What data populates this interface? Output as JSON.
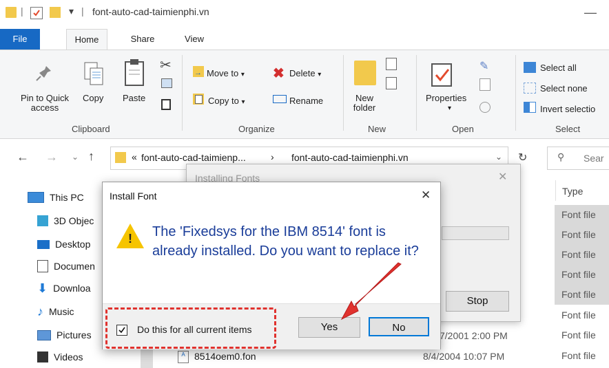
{
  "window": {
    "title": "font-auto-cad-taimienphi.vn",
    "separator": "|",
    "minimize_glyph": "—",
    "pin_glyph": "⌄"
  },
  "tabs": [
    "File",
    "Home",
    "Share",
    "View"
  ],
  "ribbon": {
    "clipboard": {
      "group_label": "Clipboard",
      "pin_label_1": "Pin to Quick",
      "pin_label_2": "access",
      "copy": "Copy",
      "paste": "Paste"
    },
    "organize": {
      "group_label": "Organize",
      "move_to": "Move to",
      "copy_to": "Copy to",
      "delete": "Delete",
      "rename": "Rename"
    },
    "new": {
      "group_label": "New",
      "new_folder_1": "New",
      "new_folder_2": "folder"
    },
    "open": {
      "group_label": "Open",
      "properties": "Properties"
    },
    "select": {
      "group_label": "Select",
      "select_all": "Select all",
      "select_none": "Select none",
      "invert_selection": "Invert selectio"
    }
  },
  "address": {
    "prefix": "«",
    "crumb1": "font-auto-cad-taimienp...",
    "chevron": "›",
    "crumb2": "font-auto-cad-taimienphi.vn",
    "search_placeholder": "Sear"
  },
  "sidebar": {
    "items": [
      {
        "label": "This PC"
      },
      {
        "label": "3D Objec"
      },
      {
        "label": "Desktop"
      },
      {
        "label": "Documen"
      },
      {
        "label": "Downloa"
      },
      {
        "label": "Music"
      },
      {
        "label": "Pictures"
      },
      {
        "label": "Videos"
      }
    ]
  },
  "filelist": {
    "type_header": "Type",
    "types": [
      "Font file",
      "Font file",
      "Font file",
      "Font file",
      "Font file",
      "Font file",
      "Font file",
      "Font file"
    ],
    "visible_row_date": "7/2001 2:00 PM",
    "last_file_name": "8514oem0.fon",
    "last_file_date": "8/4/2004 10:07 PM"
  },
  "installing_dialog": {
    "title": "Installing Fonts",
    "close": "✕",
    "stop": "Stop"
  },
  "install_dialog": {
    "title": "Install Font",
    "close": "✕",
    "warning_glyph": "!",
    "message": "The 'Fixedsys for the IBM 8514' font is already installed. Do you want to replace it?",
    "checkbox_label": "Do this for all current items",
    "checkbox_checked": true,
    "yes": "Yes",
    "no": "No"
  },
  "colors": {
    "accent": "#1769c4",
    "warning": "#f6c400",
    "highlight": "#e0322e",
    "selection": "#d9d9d9"
  }
}
